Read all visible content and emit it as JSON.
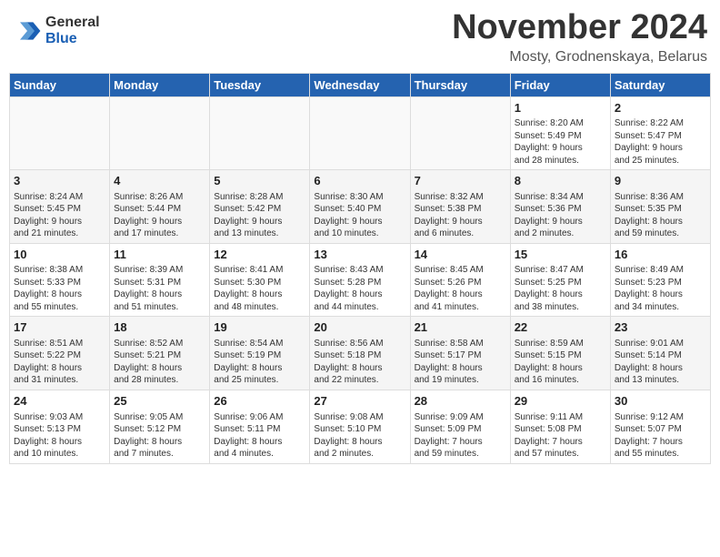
{
  "header": {
    "logo": {
      "general": "General",
      "blue": "Blue"
    },
    "title": "November 2024",
    "location": "Mosty, Grodnenskaya, Belarus"
  },
  "weekdays": [
    "Sunday",
    "Monday",
    "Tuesday",
    "Wednesday",
    "Thursday",
    "Friday",
    "Saturday"
  ],
  "weeks": [
    [
      {
        "day": "",
        "info": ""
      },
      {
        "day": "",
        "info": ""
      },
      {
        "day": "",
        "info": ""
      },
      {
        "day": "",
        "info": ""
      },
      {
        "day": "",
        "info": ""
      },
      {
        "day": "1",
        "info": "Sunrise: 8:20 AM\nSunset: 5:49 PM\nDaylight: 9 hours\nand 28 minutes."
      },
      {
        "day": "2",
        "info": "Sunrise: 8:22 AM\nSunset: 5:47 PM\nDaylight: 9 hours\nand 25 minutes."
      }
    ],
    [
      {
        "day": "3",
        "info": "Sunrise: 8:24 AM\nSunset: 5:45 PM\nDaylight: 9 hours\nand 21 minutes."
      },
      {
        "day": "4",
        "info": "Sunrise: 8:26 AM\nSunset: 5:44 PM\nDaylight: 9 hours\nand 17 minutes."
      },
      {
        "day": "5",
        "info": "Sunrise: 8:28 AM\nSunset: 5:42 PM\nDaylight: 9 hours\nand 13 minutes."
      },
      {
        "day": "6",
        "info": "Sunrise: 8:30 AM\nSunset: 5:40 PM\nDaylight: 9 hours\nand 10 minutes."
      },
      {
        "day": "7",
        "info": "Sunrise: 8:32 AM\nSunset: 5:38 PM\nDaylight: 9 hours\nand 6 minutes."
      },
      {
        "day": "8",
        "info": "Sunrise: 8:34 AM\nSunset: 5:36 PM\nDaylight: 9 hours\nand 2 minutes."
      },
      {
        "day": "9",
        "info": "Sunrise: 8:36 AM\nSunset: 5:35 PM\nDaylight: 8 hours\nand 59 minutes."
      }
    ],
    [
      {
        "day": "10",
        "info": "Sunrise: 8:38 AM\nSunset: 5:33 PM\nDaylight: 8 hours\nand 55 minutes."
      },
      {
        "day": "11",
        "info": "Sunrise: 8:39 AM\nSunset: 5:31 PM\nDaylight: 8 hours\nand 51 minutes."
      },
      {
        "day": "12",
        "info": "Sunrise: 8:41 AM\nSunset: 5:30 PM\nDaylight: 8 hours\nand 48 minutes."
      },
      {
        "day": "13",
        "info": "Sunrise: 8:43 AM\nSunset: 5:28 PM\nDaylight: 8 hours\nand 44 minutes."
      },
      {
        "day": "14",
        "info": "Sunrise: 8:45 AM\nSunset: 5:26 PM\nDaylight: 8 hours\nand 41 minutes."
      },
      {
        "day": "15",
        "info": "Sunrise: 8:47 AM\nSunset: 5:25 PM\nDaylight: 8 hours\nand 38 minutes."
      },
      {
        "day": "16",
        "info": "Sunrise: 8:49 AM\nSunset: 5:23 PM\nDaylight: 8 hours\nand 34 minutes."
      }
    ],
    [
      {
        "day": "17",
        "info": "Sunrise: 8:51 AM\nSunset: 5:22 PM\nDaylight: 8 hours\nand 31 minutes."
      },
      {
        "day": "18",
        "info": "Sunrise: 8:52 AM\nSunset: 5:21 PM\nDaylight: 8 hours\nand 28 minutes."
      },
      {
        "day": "19",
        "info": "Sunrise: 8:54 AM\nSunset: 5:19 PM\nDaylight: 8 hours\nand 25 minutes."
      },
      {
        "day": "20",
        "info": "Sunrise: 8:56 AM\nSunset: 5:18 PM\nDaylight: 8 hours\nand 22 minutes."
      },
      {
        "day": "21",
        "info": "Sunrise: 8:58 AM\nSunset: 5:17 PM\nDaylight: 8 hours\nand 19 minutes."
      },
      {
        "day": "22",
        "info": "Sunrise: 8:59 AM\nSunset: 5:15 PM\nDaylight: 8 hours\nand 16 minutes."
      },
      {
        "day": "23",
        "info": "Sunrise: 9:01 AM\nSunset: 5:14 PM\nDaylight: 8 hours\nand 13 minutes."
      }
    ],
    [
      {
        "day": "24",
        "info": "Sunrise: 9:03 AM\nSunset: 5:13 PM\nDaylight: 8 hours\nand 10 minutes."
      },
      {
        "day": "25",
        "info": "Sunrise: 9:05 AM\nSunset: 5:12 PM\nDaylight: 8 hours\nand 7 minutes."
      },
      {
        "day": "26",
        "info": "Sunrise: 9:06 AM\nSunset: 5:11 PM\nDaylight: 8 hours\nand 4 minutes."
      },
      {
        "day": "27",
        "info": "Sunrise: 9:08 AM\nSunset: 5:10 PM\nDaylight: 8 hours\nand 2 minutes."
      },
      {
        "day": "28",
        "info": "Sunrise: 9:09 AM\nSunset: 5:09 PM\nDaylight: 7 hours\nand 59 minutes."
      },
      {
        "day": "29",
        "info": "Sunrise: 9:11 AM\nSunset: 5:08 PM\nDaylight: 7 hours\nand 57 minutes."
      },
      {
        "day": "30",
        "info": "Sunrise: 9:12 AM\nSunset: 5:07 PM\nDaylight: 7 hours\nand 55 minutes."
      }
    ]
  ]
}
